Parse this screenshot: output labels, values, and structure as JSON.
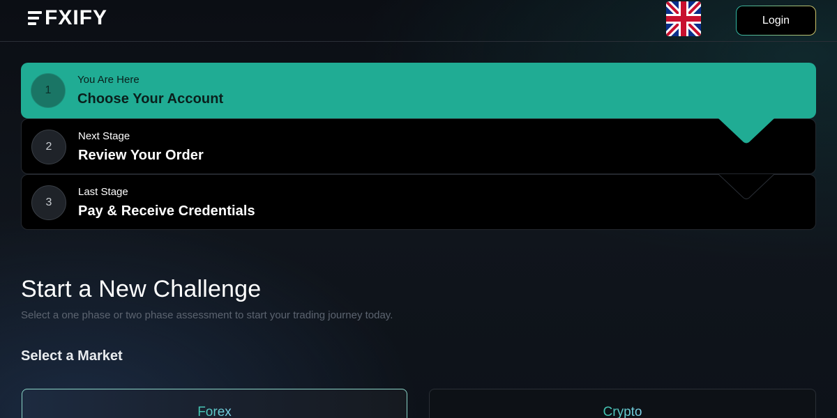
{
  "header": {
    "logo_text": "FXIFY",
    "language_flag": "uk-flag-icon",
    "login_label": "Login"
  },
  "steps": [
    {
      "number": "1",
      "kicker": "You Are Here",
      "title": "Choose Your Account",
      "state": "current"
    },
    {
      "number": "2",
      "kicker": "Next Stage",
      "title": "Review Your Order",
      "state": "upcoming"
    },
    {
      "number": "3",
      "kicker": "Last Stage",
      "title": "Pay & Receive Credentials",
      "state": "upcoming"
    }
  ],
  "challenge": {
    "title": "Start a New Challenge",
    "subtitle": "Select a one phase or two phase assessment to start your trading journey today.",
    "market_label": "Select a Market",
    "markets": [
      {
        "label": "Forex",
        "selected": true
      },
      {
        "label": "Crypto",
        "selected": false
      }
    ]
  },
  "colors": {
    "accent": "#20ac94",
    "background": "#0b0e14",
    "step_bg": "#000000",
    "muted_text": "#5c6470"
  }
}
